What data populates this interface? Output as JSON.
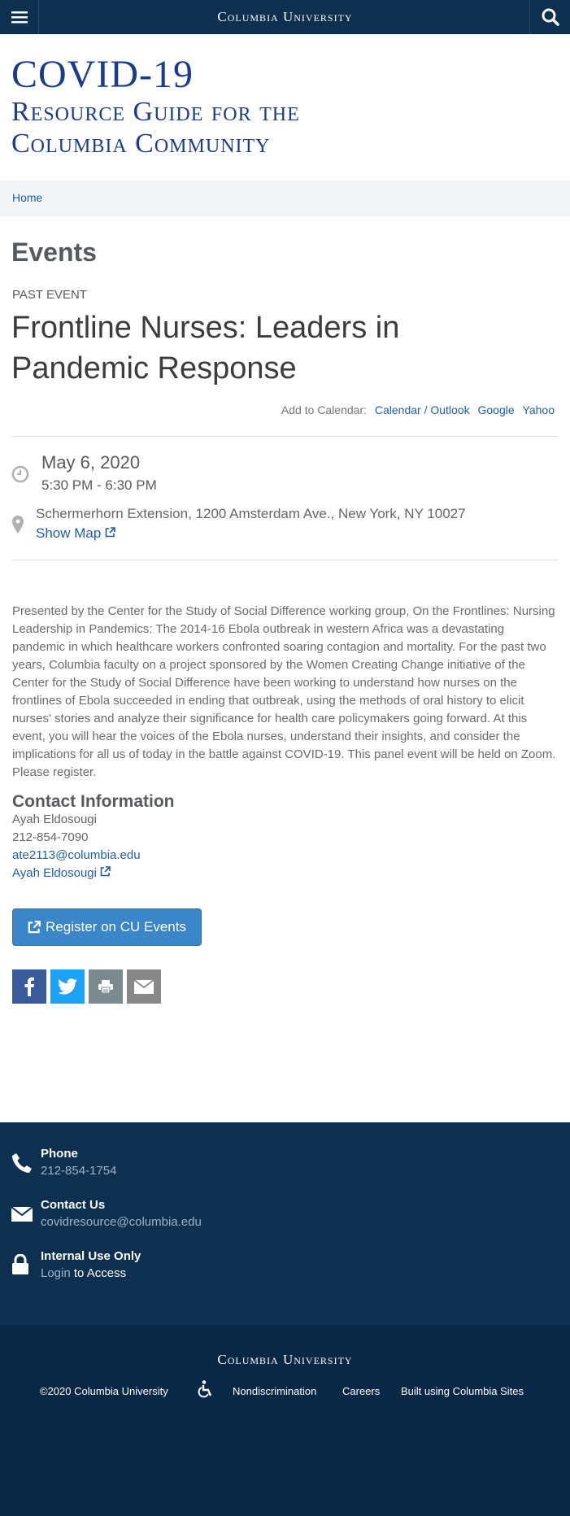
{
  "header": {
    "university": "Columbia University"
  },
  "site": {
    "title_line1": "COVID-19",
    "title_line2": "Resource Guide for the",
    "title_line3": "Columbia Community"
  },
  "breadcrumb": {
    "home": "Home"
  },
  "page": {
    "heading": "Events"
  },
  "event": {
    "status": "PAST EVENT",
    "title": "Frontline Nurses: Leaders in Pandemic Response",
    "add_to_calendar_label": "Add to Calendar:",
    "calendar_links": [
      "Calendar / Outlook",
      "Google",
      "Yahoo"
    ],
    "date": "May 6, 2020",
    "time": "5:30 PM - 6:30 PM",
    "location": "Schermerhorn Extension, 1200 Amsterdam Ave., New York, NY 10027",
    "show_map": "Show Map",
    "description": "Presented by the Center for the Study of Social Difference working group, On the Frontlines: Nursing Leadership in Pandemics: The 2014-16 Ebola outbreak in western Africa was a devastating pandemic in which healthcare workers confronted soaring contagion and mortality. For the past two years, Columbia faculty on a project sponsored by the Women Creating Change initiative of the Center for the Study of Social Difference have been working to understand how nurses on the frontlines of Ebola succeeded in ending that outbreak, using the methods of oral history to elicit nurses' stories and analyze their significance for health care policymakers going forward. At this event, you will hear the voices of the Ebola nurses, understand their insights, and consider the implications for all us of today in the battle against COVID-19. This panel event will be held on Zoom. Please register."
  },
  "contact": {
    "heading": "Contact Information",
    "name": "Ayah Eldosougi",
    "phone": "212-854-7090",
    "email": "ate2113@columbia.edu",
    "link": "Ayah Eldosougi"
  },
  "register": {
    "label": "Register on CU Events"
  },
  "share": {
    "icons": [
      "facebook-icon",
      "twitter-icon",
      "print-icon",
      "email-icon"
    ],
    "colors": {
      "facebook": "#3b5a9a",
      "twitter": "#1da1f2",
      "print": "#7a8a8f",
      "email": "#888888"
    }
  },
  "footer": {
    "phone_label": "Phone",
    "phone_value": "212-854-1754",
    "contact_label": "Contact Us",
    "contact_value": "covidresource@columbia.edu",
    "internal_label": "Internal Use Only",
    "login_link": "Login",
    "login_suffix": "to Access"
  },
  "bottom": {
    "university": "Columbia University",
    "copyright": "©2020 Columbia University",
    "nondiscrimination": "Nondiscrimination",
    "careers": "Careers",
    "built": "Built using Columbia Sites"
  },
  "colors": {
    "header_bg": "#0d3050",
    "footer_bg": "#0d3050",
    "bottom_bg": "#082845",
    "accent": "#1f5fa6",
    "title_blue": "#1b3b8c",
    "button": "#3b86c9"
  }
}
